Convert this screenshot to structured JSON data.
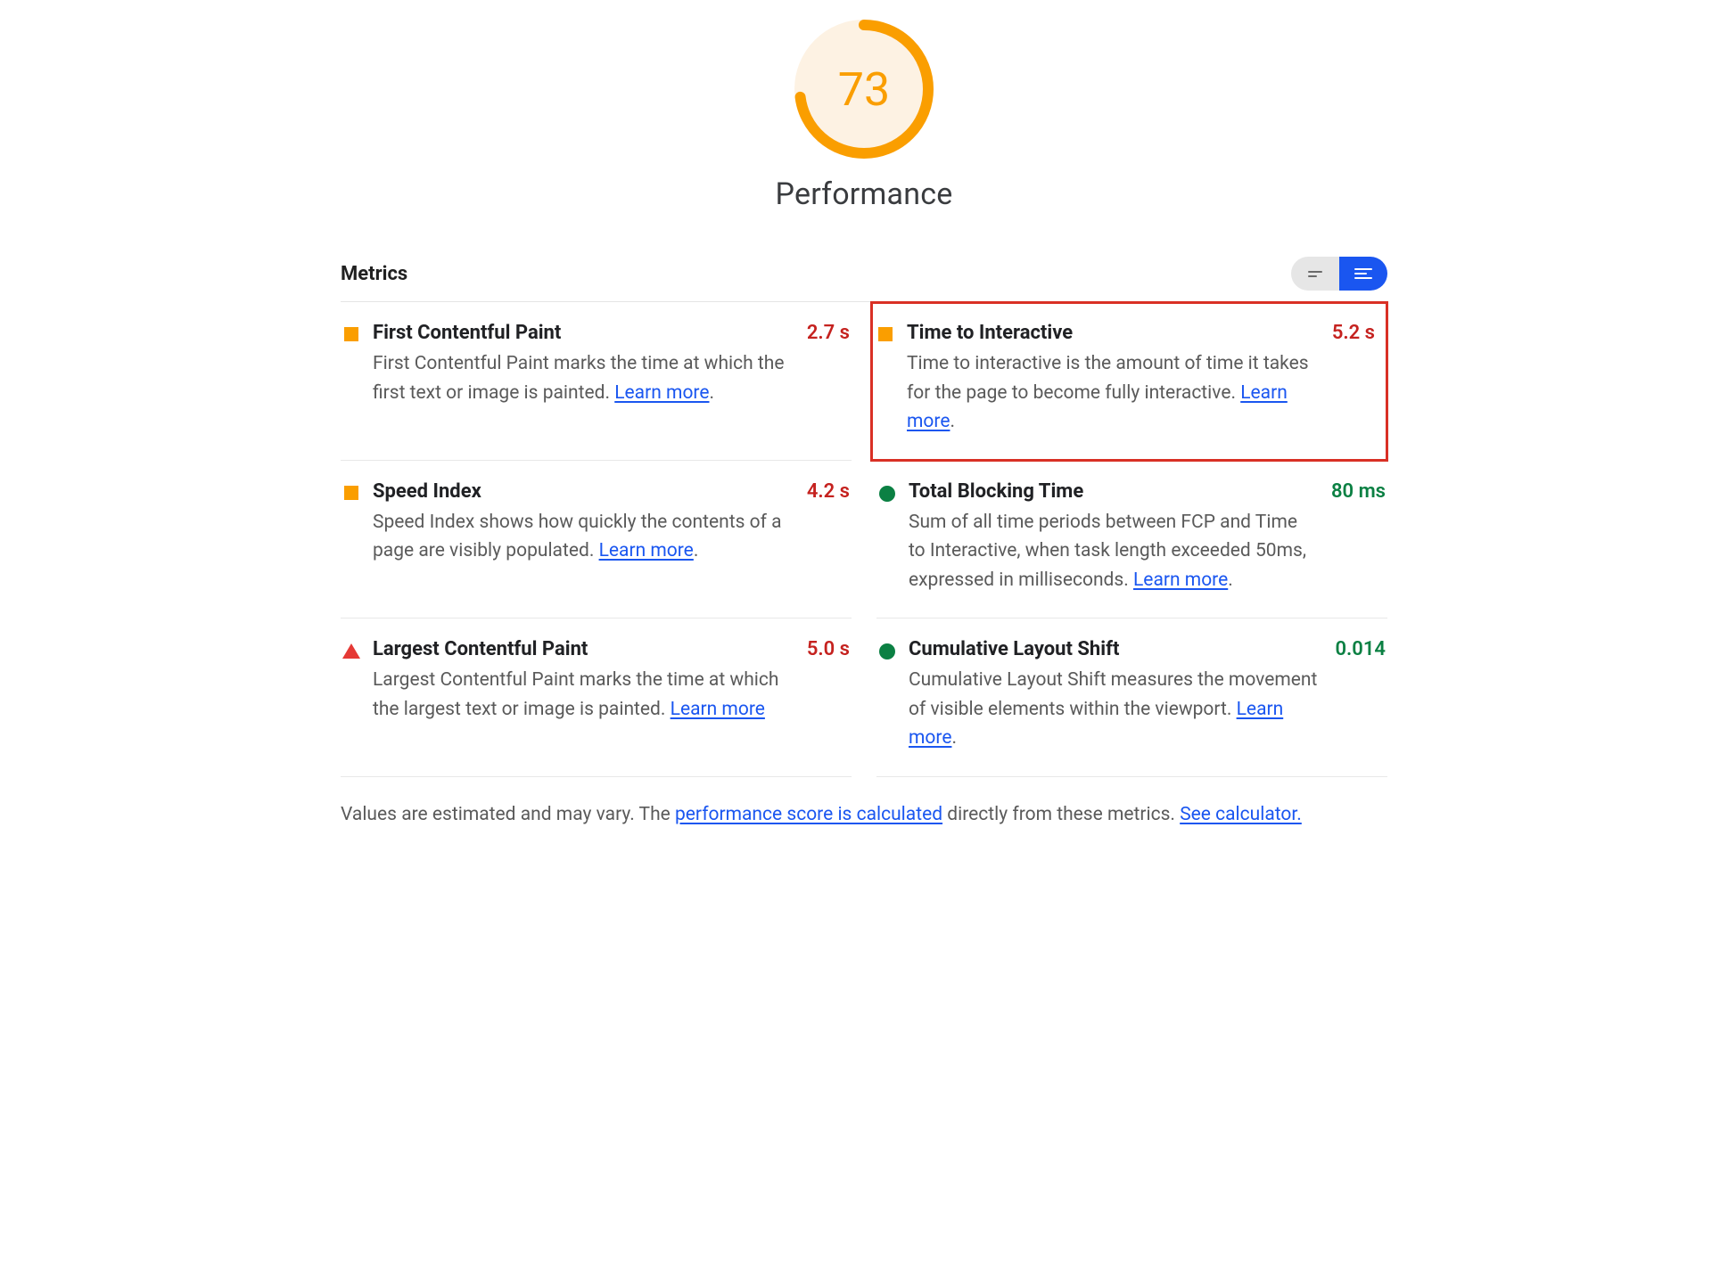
{
  "score": {
    "value": "73",
    "percent": 73,
    "category": "Performance"
  },
  "sectionTitle": "Metrics",
  "learnMore": "Learn more",
  "metrics": {
    "fcp": {
      "title": "First Contentful Paint",
      "value": "2.7 s",
      "status": "avg",
      "desc": "First Contentful Paint marks the time at which the first text or image is painted. ",
      "suffix": "."
    },
    "tti": {
      "title": "Time to Interactive",
      "value": "5.2 s",
      "status": "avg",
      "desc": "Time to interactive is the amount of time it takes for the page to become fully interactive. ",
      "suffix": "."
    },
    "si": {
      "title": "Speed Index",
      "value": "4.2 s",
      "status": "avg",
      "desc": "Speed Index shows how quickly the contents of a page are visibly populated. ",
      "suffix": "."
    },
    "tbt": {
      "title": "Total Blocking Time",
      "value": "80 ms",
      "status": "good",
      "desc": "Sum of all time periods between FCP and Time to Interactive, when task length exceeded 50ms, expressed in milliseconds. ",
      "suffix": "."
    },
    "lcp": {
      "title": "Largest Contentful Paint",
      "value": "5.0 s",
      "status": "fail",
      "desc": "Largest Contentful Paint marks the time at which the largest text or image is painted. ",
      "suffix": ""
    },
    "cls": {
      "title": "Cumulative Layout Shift",
      "value": "0.014",
      "status": "good",
      "desc": "Cumulative Layout Shift measures the movement of visible elements within the viewport. ",
      "suffix": "."
    }
  },
  "footnote": {
    "pre": "Values are estimated and may vary. The ",
    "link1": "performance score is calculated",
    "mid": " directly from these metrics. ",
    "link2": "See calculator."
  }
}
